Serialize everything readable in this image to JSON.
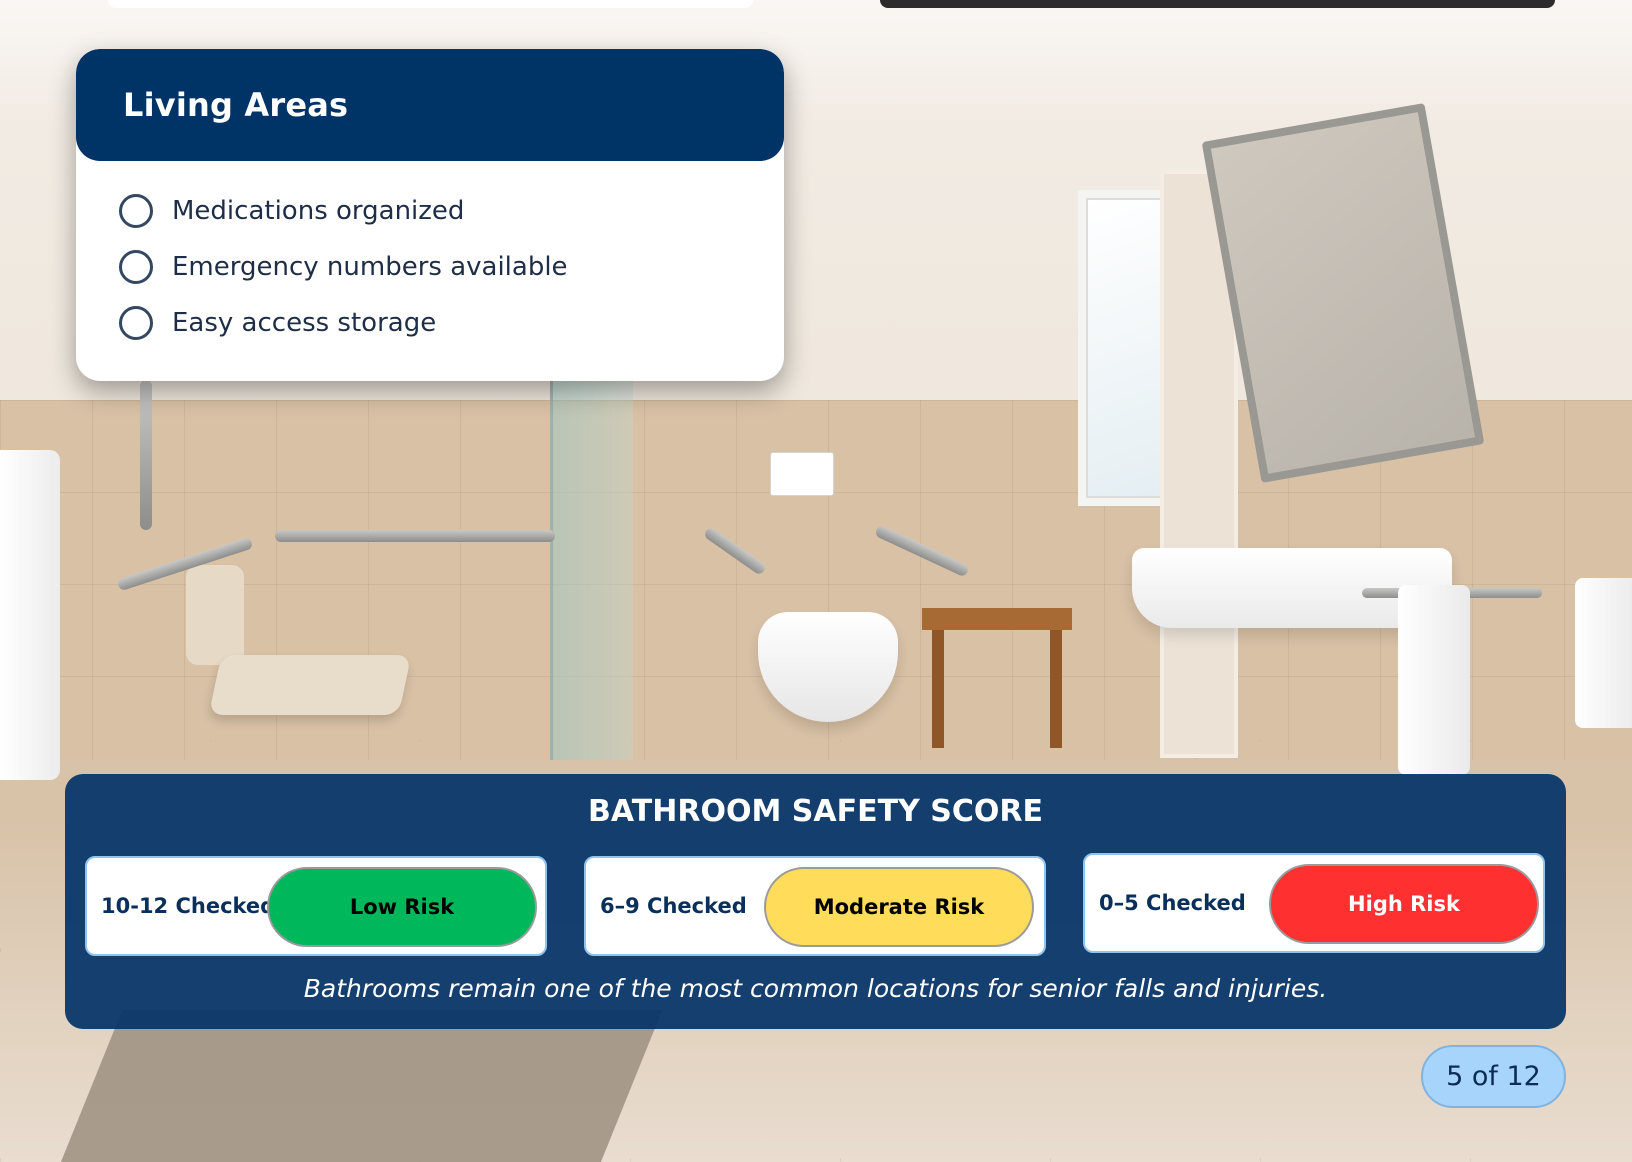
{
  "checklist_card": {
    "title": "Living Areas",
    "items": [
      {
        "label": "Medications organized",
        "checked": false
      },
      {
        "label": "Emergency numbers available",
        "checked": false
      },
      {
        "label": "Easy access storage",
        "checked": false
      }
    ],
    "header_color": "#003366"
  },
  "safety_score": {
    "title": "BATHROOM SAFETY SCORE",
    "levels": [
      {
        "range": "10-12 Checked",
        "label": "Low Risk",
        "color": "#00b85c",
        "text_color": "#000000"
      },
      {
        "range": "6–9 Checked",
        "label": "Moderate Risk",
        "color": "#ffdc5a",
        "text_color": "#000000"
      },
      {
        "range": "0–5 Checked",
        "label": "High Risk",
        "color": "#ff3030",
        "text_color": "#ffffff"
      }
    ],
    "note": "Bathrooms remain one of the most common locations for senior falls and injuries.",
    "panel_color": "#043468"
  },
  "pagination": {
    "label": "5 of 12",
    "current": 5,
    "total": 12,
    "color": "#a6d4fb"
  },
  "background": {
    "scene": "accessible bathroom with grab bars, shower seat, toilet, wooden stool, sink and mirror"
  }
}
